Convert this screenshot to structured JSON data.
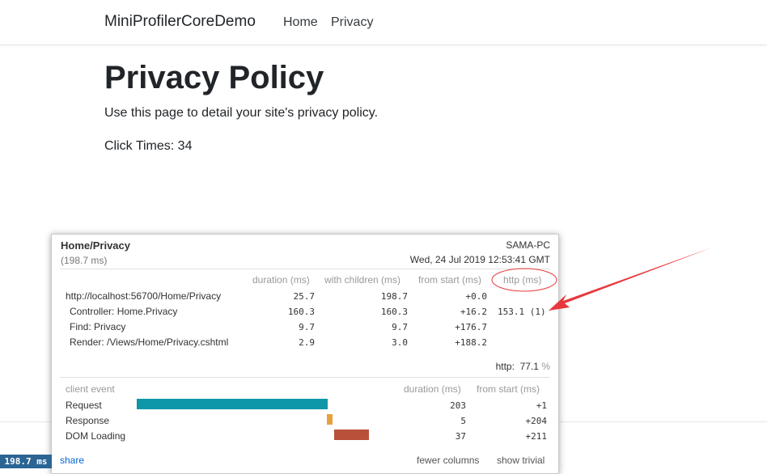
{
  "navbar": {
    "brand": "MiniProfilerCoreDemo",
    "links": [
      "Home",
      "Privacy"
    ]
  },
  "page": {
    "title": "Privacy Policy",
    "lead": "Use this page to detail your site's privacy policy.",
    "clicks": "Click Times: 34"
  },
  "profiler": {
    "name": "Home/Privacy",
    "total": "(198.7 ms)",
    "machine": "SAMA-PC",
    "timestamp": "Wed, 24 Jul 2019 12:53:41 GMT",
    "columns": [
      "duration (ms)",
      "with children (ms)",
      "from start (ms)",
      "http (ms)"
    ],
    "timings": [
      {
        "label": "http://localhost:56700/Home/Privacy",
        "duration": "25.7",
        "children": "198.7",
        "start": "+0.0",
        "http": ""
      },
      {
        "label": "Controller: Home.Privacy",
        "duration": "160.3",
        "children": "160.3",
        "start": "+16.2",
        "http": "153.1 (1)"
      },
      {
        "label": "Find: Privacy",
        "duration": "9.7",
        "children": "9.7",
        "start": "+176.7",
        "http": ""
      },
      {
        "label": "Render: /Views/Home/Privacy.cshtml",
        "duration": "2.9",
        "children": "3.0",
        "start": "+188.2",
        "http": ""
      }
    ],
    "http_summary": {
      "label": "http:",
      "value": "77.1",
      "unit": "%"
    },
    "client_columns": [
      "client event",
      "duration (ms)",
      "from start (ms)"
    ],
    "client_events": [
      {
        "label": "Request",
        "duration": "203",
        "start": "+1",
        "color": "#0e97a7"
      },
      {
        "label": "Response",
        "duration": "5",
        "start": "+204",
        "color": "#e6a23c"
      },
      {
        "label": "DOM Loading",
        "duration": "37",
        "start": "+211",
        "color": "#b8503a"
      }
    ],
    "links": {
      "share": "share",
      "fewer": "fewer columns",
      "trivial": "show trivial"
    }
  },
  "badge": "198.7 ms",
  "annotation_color": "#e8383d"
}
